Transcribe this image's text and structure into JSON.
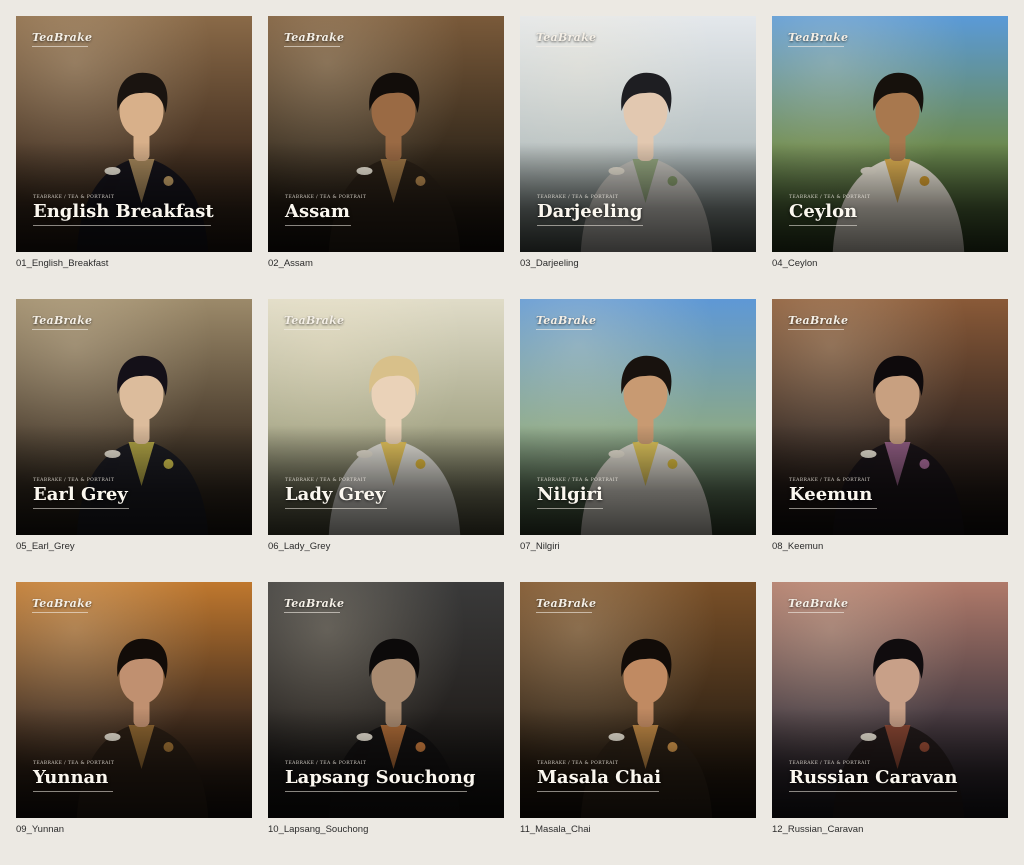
{
  "gallery": {
    "items": [
      {
        "brand": "TeaBrake",
        "kicker": "TEABRAKE / TEA & PORTRAIT",
        "name": "English Breakfast",
        "caption": "01_English_Breakfast",
        "palette": {
          "top": "#8a6a48",
          "mid": "#4a3524",
          "bottom": "#1c140e",
          "coat": "#15131a",
          "skin": "#d8b08a",
          "hair": "#1a1410",
          "accent": "#c8a46a"
        }
      },
      {
        "brand": "TeaBrake",
        "kicker": "TEABRAKE / TEA & PORTRAIT",
        "name": "Assam",
        "caption": "02_Assam",
        "palette": {
          "top": "#7a5a3a",
          "mid": "#3a2d1e",
          "bottom": "#140f0a",
          "coat": "#2a2016",
          "skin": "#9a6a44",
          "hair": "#120d0a",
          "accent": "#b88a50"
        }
      },
      {
        "brand": "TeaBrake",
        "kicker": "TEABRAKE / TEA & PORTRAIT",
        "name": "Darjeeling",
        "caption": "03_Darjeeling",
        "palette": {
          "top": "#e4e8ec",
          "mid": "#b8c2c4",
          "bottom": "#4e5650",
          "coat": "#c4c2bc",
          "skin": "#e2c8b0",
          "hair": "#1e1e22",
          "accent": "#8aa070"
        }
      },
      {
        "brand": "TeaBrake",
        "kicker": "TEABRAKE / TEA & PORTRAIT",
        "name": "Ceylon",
        "caption": "04_Ceylon",
        "palette": {
          "top": "#5a9ad8",
          "mid": "#6c8a50",
          "bottom": "#2a3a1e",
          "coat": "#ece6d8",
          "skin": "#a8784e",
          "hair": "#16110c",
          "accent": "#d8a030"
        }
      },
      {
        "brand": "TeaBrake",
        "kicker": "TEABRAKE / TEA & PORTRAIT",
        "name": "Earl Grey",
        "caption": "05_Earl_Grey",
        "palette": {
          "top": "#9c8a6a",
          "mid": "#4e4030",
          "bottom": "#1a1510",
          "coat": "#1c1c22",
          "skin": "#dcbc9c",
          "hair": "#141018",
          "accent": "#d8c850"
        }
      },
      {
        "brand": "TeaBrake",
        "kicker": "TEABRAKE / TEA & PORTRAIT",
        "name": "Lady Grey",
        "caption": "06_Lady_Grey",
        "palette": {
          "top": "#e0dcc8",
          "mid": "#a8a88a",
          "bottom": "#4a4a36",
          "coat": "#e4e2da",
          "skin": "#ead2b8",
          "hair": "#d8c08a",
          "accent": "#e8c040"
        }
      },
      {
        "brand": "TeaBrake",
        "kicker": "TEABRAKE / TEA & PORTRAIT",
        "name": "Nilgiri",
        "caption": "07_Nilgiri",
        "palette": {
          "top": "#5e98d6",
          "mid": "#8aa88a",
          "bottom": "#34442e",
          "coat": "#e0dcd2",
          "skin": "#c89a72",
          "hair": "#18120e",
          "accent": "#e0c040"
        }
      },
      {
        "brand": "TeaBrake",
        "kicker": "TEABRAKE / TEA & PORTRAIT",
        "name": "Keemun",
        "caption": "08_Keemun",
        "palette": {
          "top": "#8a5a38",
          "mid": "#3a2a22",
          "bottom": "#120e0c",
          "coat": "#1a1418",
          "skin": "#c8a080",
          "hair": "#0e0a0c",
          "accent": "#b070a0"
        }
      },
      {
        "brand": "TeaBrake",
        "kicker": "TEABRAKE / TEA & PORTRAIT",
        "name": "Yunnan",
        "caption": "09_Yunnan",
        "palette": {
          "top": "#c0782e",
          "mid": "#4a3220",
          "bottom": "#140e0a",
          "coat": "#2a1e14",
          "skin": "#c09070",
          "hair": "#120c08",
          "accent": "#a87838"
        }
      },
      {
        "brand": "TeaBrake",
        "kicker": "TEABRAKE / TEA & PORTRAIT",
        "name": "Lapsang Souchong",
        "caption": "10_Lapsang_Souchong",
        "palette": {
          "top": "#3a3a3a",
          "mid": "#252220",
          "bottom": "#0e0c0b",
          "coat": "#141212",
          "skin": "#a88a70",
          "hair": "#0c0a0a",
          "accent": "#d08040"
        }
      },
      {
        "brand": "TeaBrake",
        "kicker": "TEABRAKE / TEA & PORTRAIT",
        "name": "Masala Chai",
        "caption": "11_Masala_Chai",
        "palette": {
          "top": "#7a5028",
          "mid": "#3c2a18",
          "bottom": "#140e08",
          "coat": "#2e2216",
          "skin": "#c08a62",
          "hair": "#120c08",
          "accent": "#e0a050"
        }
      },
      {
        "brand": "TeaBrake",
        "kicker": "TEABRAKE / TEA & PORTRAIT",
        "name": "Russian Caravan",
        "caption": "12_Russian_Caravan",
        "palette": {
          "top": "#b07a6a",
          "mid": "#4c3e44",
          "bottom": "#16141a",
          "coat": "#221a1a",
          "skin": "#c8a088",
          "hair": "#100c0e",
          "accent": "#a05038"
        }
      }
    ]
  }
}
